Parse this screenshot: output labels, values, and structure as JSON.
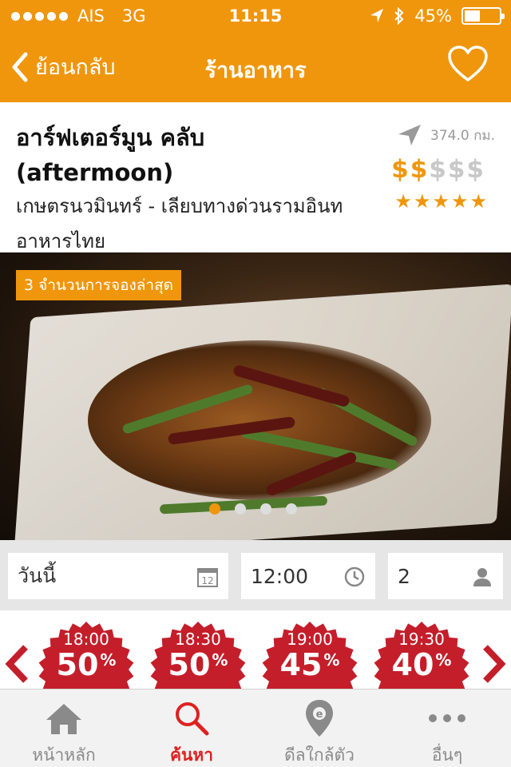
{
  "status_bar": {
    "carrier": "AIS",
    "network": "3G",
    "time": "11:15",
    "battery": "45%",
    "battery_level": 0.45
  },
  "nav": {
    "back_label": "ย้อนกลับ",
    "title": "ร้านอาหาร",
    "favorite_icon": "heart-outline-icon"
  },
  "restaurant": {
    "name_th": "อาร์ฟเตอร์มูน คลับ",
    "name_en": "(aftermoon)",
    "area": "เกษตรนวมินทร์ - เลียบทางด่วนรามอินท",
    "cuisine": "อาหารไทย",
    "distance": "374.0 กม.",
    "price_level": 2,
    "price_max": 5,
    "price_symbol": "$",
    "rating": 5,
    "rating_max": 5
  },
  "photo": {
    "badge": "3 จำนวนการจองล่าสุด",
    "page_count": 4,
    "active_page": 1
  },
  "booking": {
    "date": "วันนี้",
    "calendar_day": "12",
    "time": "12:00",
    "party_size": "2"
  },
  "deals": [
    {
      "time": "18:00",
      "discount": "50",
      "unit": "%"
    },
    {
      "time": "18:30",
      "discount": "50",
      "unit": "%"
    },
    {
      "time": "19:00",
      "discount": "45",
      "unit": "%"
    },
    {
      "time": "19:30",
      "discount": "40",
      "unit": "%"
    }
  ],
  "tabs": [
    {
      "label": "หน้าหลัก",
      "icon": "home-icon"
    },
    {
      "label": "ค้นหา",
      "icon": "search-icon"
    },
    {
      "label": "ดีลใกล้ตัว",
      "icon": "map-pin-icon"
    },
    {
      "label": "อื่นๆ",
      "icon": "more-icon"
    }
  ],
  "colors": {
    "brand": "#f0960c",
    "deal_red": "#c41e2a",
    "active_tab": "#e02020"
  }
}
